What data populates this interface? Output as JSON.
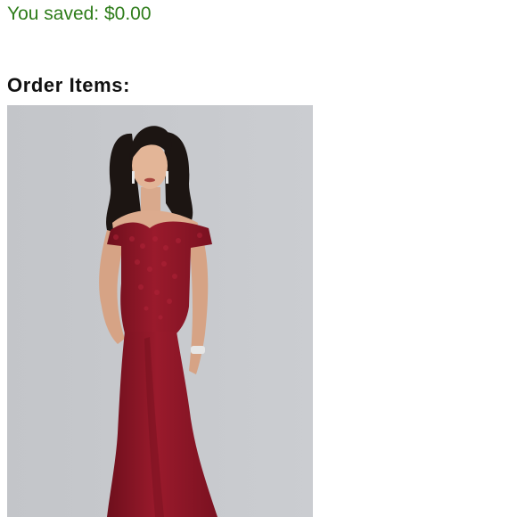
{
  "savings": {
    "text": "You saved: $0.00",
    "color": "#2e7d1a"
  },
  "order_items": {
    "heading": "Order Items:",
    "items": [
      {
        "image_icon": "product-photo-red-off-shoulder-gown",
        "dress_color": "#8e1526"
      }
    ]
  }
}
